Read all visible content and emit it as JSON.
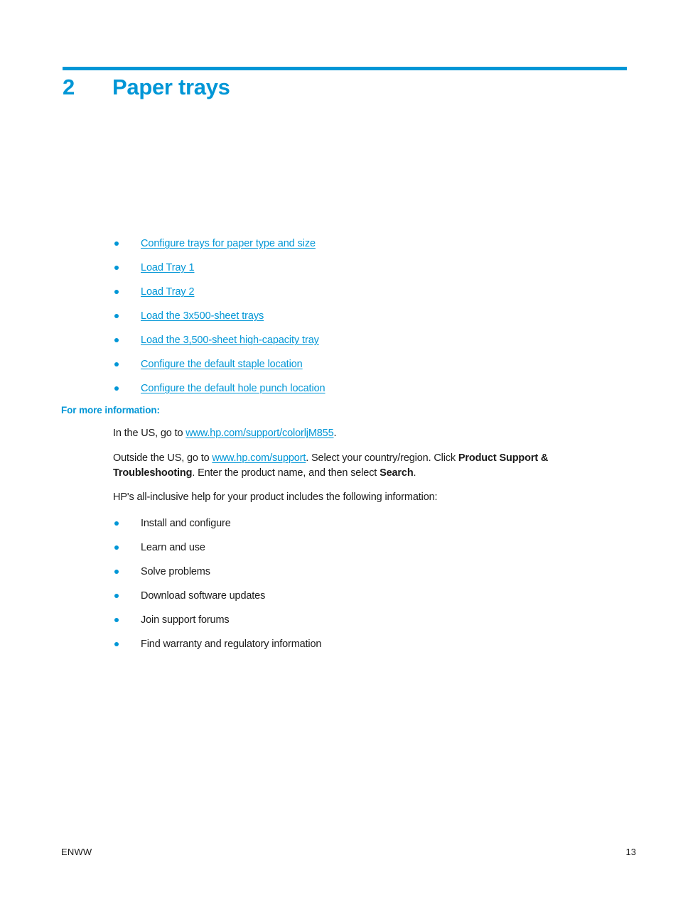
{
  "document": {
    "chapter_number": "2",
    "chapter_title": "Paper trays",
    "accent_color": "#0096d6",
    "text_color": "#1a1a1a"
  },
  "toc_links": [
    {
      "label": "Configure trays for paper type and size"
    },
    {
      "label": "Load Tray 1"
    },
    {
      "label": "Load Tray 2"
    },
    {
      "label": "Load the 3x500-sheet trays"
    },
    {
      "label": "Load the 3,500-sheet high-capacity tray"
    },
    {
      "label": "Configure the default staple location"
    },
    {
      "label": "Configure the default hole punch location"
    }
  ],
  "more_info": {
    "heading": "For more information:",
    "para_us": {
      "before": "In the US, go to ",
      "link": "www.hp.com/support/colorljM855",
      "after": "."
    },
    "para_outside": {
      "before": "Outside the US, go to ",
      "link": "www.hp.com/support",
      "mid1": ". Select your country/region. Click ",
      "bold1": "Product Support & Troubleshooting",
      "mid2": ". Enter the product name, and then select ",
      "bold2": "Search",
      "after": "."
    },
    "intro": "HP's all-inclusive help for your product includes the following information:",
    "items": [
      {
        "label": "Install and configure"
      },
      {
        "label": "Learn and use"
      },
      {
        "label": "Solve problems"
      },
      {
        "label": "Download software updates"
      },
      {
        "label": "Join support forums"
      },
      {
        "label": "Find warranty and regulatory information"
      }
    ]
  },
  "footer": {
    "locale": "ENWW",
    "page_number": "13"
  }
}
